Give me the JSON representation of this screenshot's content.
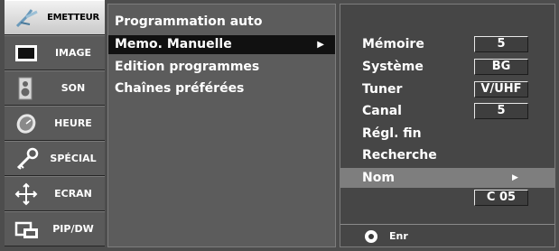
{
  "categories": [
    {
      "label": "EMETTEUR",
      "icon": "antenna-icon",
      "selected": true
    },
    {
      "label": "IMAGE",
      "icon": "screen-icon",
      "selected": false
    },
    {
      "label": "SON",
      "icon": "speaker-icon",
      "selected": false
    },
    {
      "label": "HEURE",
      "icon": "clock-icon",
      "selected": false
    },
    {
      "label": "SPÉCIAL",
      "icon": "key-icon",
      "selected": false
    },
    {
      "label": "ECRAN",
      "icon": "move-arrows-icon",
      "selected": false
    },
    {
      "label": "PIP/DW",
      "icon": "pip-icon",
      "selected": false
    }
  ],
  "menu": {
    "items": [
      {
        "label": "Programmation auto",
        "selected": false
      },
      {
        "label": "Memo. Manuelle",
        "selected": true,
        "arrow": "▶"
      },
      {
        "label": "Edition programmes",
        "selected": false
      },
      {
        "label": "Chaînes préférées",
        "selected": false
      }
    ]
  },
  "settings": {
    "rows": [
      {
        "label": "Mémoire",
        "value": "5"
      },
      {
        "label": "Système",
        "value": "BG"
      },
      {
        "label": "Tuner",
        "value": "V/UHF"
      },
      {
        "label": "Canal",
        "value": "5"
      },
      {
        "label": "Régl. fin",
        "value": null
      },
      {
        "label": "Recherche",
        "value": null
      }
    ],
    "nom": {
      "label": "Nom",
      "arrow": "▶",
      "value": "C 05"
    },
    "footer": {
      "label": "Enr"
    }
  },
  "colors": {
    "background": "#4d4d4d",
    "selected_category": "#dcdcdc",
    "selected_item": "#111111",
    "highlight_row": "#7e7e7e",
    "text": "#ffffff"
  }
}
